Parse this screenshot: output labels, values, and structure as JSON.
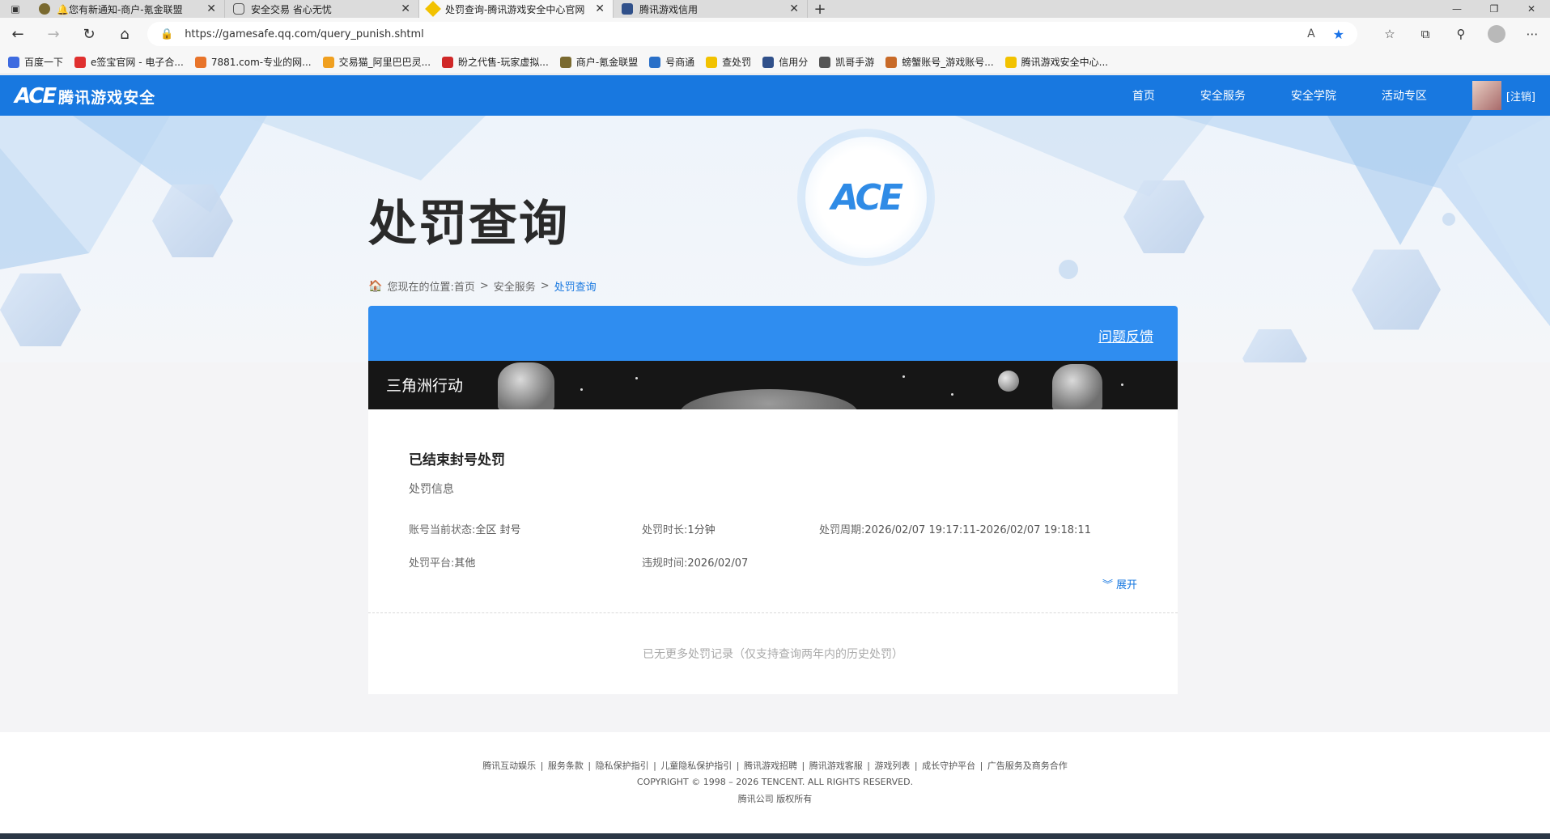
{
  "browser": {
    "tabs": [
      {
        "label": "🔔您有新通知-商户-氪金联盟",
        "active": false
      },
      {
        "label": "安全交易 省心无忧",
        "active": false
      },
      {
        "label": "处罚查询-腾讯游戏安全中心官网",
        "active": true
      },
      {
        "label": "腾讯游戏信用",
        "active": false
      }
    ],
    "url": "https://gamesafe.qq.com/query_punish.shtml",
    "bookmarks": [
      {
        "label": "百度一下",
        "color": "#3e6be0"
      },
      {
        "label": "e签宝官网 - 电子合...",
        "color": "#e0302f"
      },
      {
        "label": "7881.com-专业的网...",
        "color": "#e8742a"
      },
      {
        "label": "交易猫_阿里巴巴灵...",
        "color": "#f0a020"
      },
      {
        "label": "盼之代售-玩家虚拟...",
        "color": "#d02828"
      },
      {
        "label": "商户-氪金联盟",
        "color": "#7a6a30"
      },
      {
        "label": "号商通",
        "color": "#2a70c8"
      },
      {
        "label": "查处罚",
        "color": "#f2c200"
      },
      {
        "label": "信用分",
        "color": "#30508a"
      },
      {
        "label": "凯哥手游",
        "color": "#555555"
      },
      {
        "label": "螃蟹账号_游戏账号...",
        "color": "#c86a28"
      },
      {
        "label": "腾讯游戏安全中心...",
        "color": "#f2c200"
      }
    ]
  },
  "site": {
    "logo_ace": "ACE",
    "logo_name": "腾讯游戏安全",
    "nav": [
      "首页",
      "安全服务",
      "安全学院",
      "活动专区"
    ],
    "logout": "[注销]",
    "brand_color": "#1878e0"
  },
  "hero": {
    "title": "处罚查询",
    "breadcrumb_prefix": "您现在的位置:",
    "breadcrumb": [
      "首页",
      "安全服务",
      "处罚查询"
    ],
    "emblem": "ACE"
  },
  "panel": {
    "feedback": "问题反馈",
    "game": "三角洲行动",
    "record": {
      "title": "已结束封号处罚",
      "subtitle": "处罚信息",
      "status_label": "账号当前状态:",
      "status_value": "全区 封号",
      "duration_label": "处罚时长:",
      "duration_value": "1分钟",
      "period_label": "处罚周期:",
      "period_value": "2026/02/07 19:17:11-2026/02/07 19:18:11",
      "platform_label": "处罚平台:",
      "platform_value": "其他",
      "violation_label": "违规时间:",
      "violation_value": "2026/02/07",
      "expand": "展开"
    },
    "no_more": "已无更多处罚记录（仅支持查询两年内的历史处罚）"
  },
  "footer": {
    "links": [
      "腾讯互动娱乐",
      "服务条款",
      "隐私保护指引",
      "儿童隐私保护指引",
      "腾讯游戏招聘",
      "腾讯游戏客服",
      "游戏列表",
      "成长守护平台",
      "广告服务及商务合作"
    ],
    "copyright": "COPYRIGHT © 1998 – 2026 TENCENT. ALL RIGHTS RESERVED.",
    "rights": "腾讯公司 版权所有"
  }
}
